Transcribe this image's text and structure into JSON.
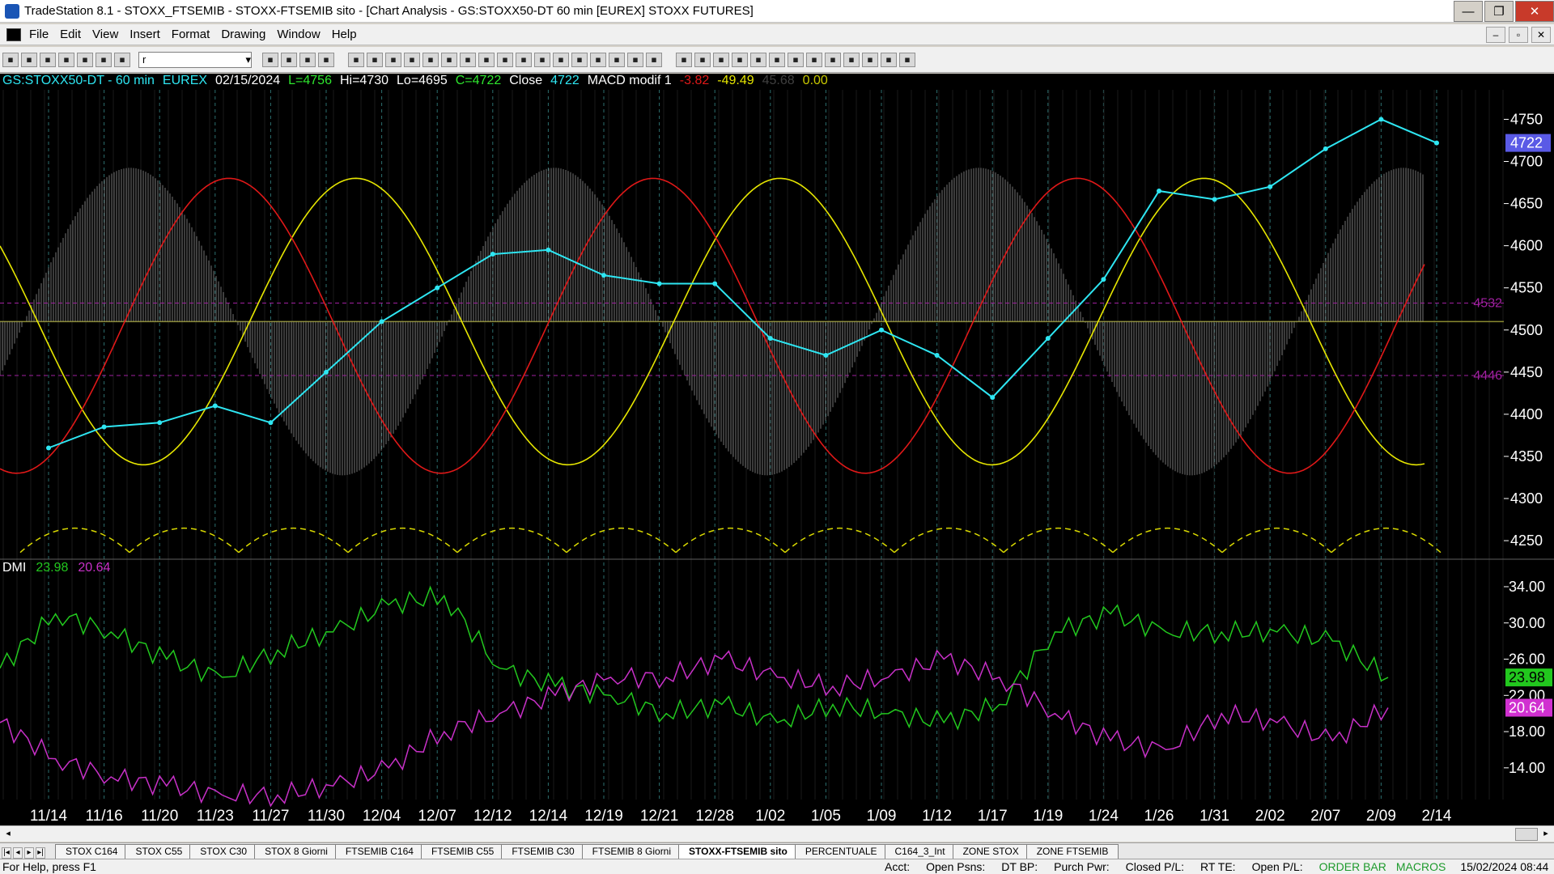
{
  "window": {
    "title": "TradeStation 8.1 - STOXX_FTSEMIB - STOXX-FTSEMIB sito - [Chart Analysis - GS:STOXX50-DT  60 min  [EUREX] STOXX FUTURES]",
    "minimize": "—",
    "restore": "❐",
    "close": "✕"
  },
  "menu": {
    "items": [
      "File",
      "Edit",
      "View",
      "Insert",
      "Format",
      "Drawing",
      "Window",
      "Help"
    ],
    "mdi": [
      "–",
      "▫",
      "✕"
    ]
  },
  "toolbar": {
    "symbol_value": "r",
    "icons_a": [
      "new-icon",
      "open-icon",
      "save-icon",
      "save-all-icon",
      "print-icon",
      "print-preview-icon",
      "workspace-icon",
      "workspace2-icon",
      "lock-icon",
      "format-icon",
      "colors-icon"
    ],
    "icons_b": [
      "insert-icon",
      "chart-icon",
      "indicator-icon",
      "study-icon",
      "strategy-icon",
      "data-icon",
      "bar-icon",
      "candle-icon",
      "line-icon",
      "point-icon",
      "zoom-in-icon",
      "zoom-out-icon",
      "cursor-icon",
      "hand-icon",
      "tools-icon",
      "export-icon",
      "grid-icon"
    ],
    "icons_c": [
      "trend-line-icon",
      "fib-icon",
      "hline-icon",
      "vline-icon",
      "arc-icon",
      "channel-icon",
      "gann-icon",
      "text-icon",
      "arrow-up-icon",
      "arrow-down-icon",
      "ellipse-icon",
      "rect-icon",
      "abc-icon"
    ]
  },
  "legend": {
    "symbol": "GS:STOXX50-DT - 60 min",
    "exchange": "EUREX",
    "date": "02/15/2024",
    "last": "L=4756",
    "hi": "Hi=4730",
    "lo": "Lo=4695",
    "close": "C=4722",
    "close_label": "Close",
    "close_val": "4722",
    "macd_name": "MACD modif 1",
    "macd_v1": "-3.82",
    "macd_v2": "-49.49",
    "macd_v3": "45.68",
    "macd_v4": "0.00"
  },
  "dmi": {
    "name": "DMI",
    "v1": "23.98",
    "v2": "20.64"
  },
  "colors": {
    "price": "#2ee6f2",
    "macd_red": "#e01818",
    "macd_yellow": "#e6e600",
    "hist": "#9a9a9a",
    "dmi_green": "#22c81e",
    "dmi_magenta": "#c830c8",
    "level_purple": "#a020a0"
  },
  "chart_data": [
    {
      "type": "line",
      "title": "GS:STOXX50-DT - 60 min",
      "y_ticks": [
        "4750",
        "4700",
        "4650",
        "4600",
        "4550",
        "4500",
        "4450",
        "4400",
        "4350",
        "4300",
        "4250"
      ],
      "ylim": [
        4228,
        4785
      ],
      "current_price_label": "4722",
      "levels": [
        {
          "label": "4532",
          "value": 4532
        },
        {
          "label": "4446",
          "value": 4446
        }
      ],
      "x_labels": [
        "11/14",
        "11/16",
        "11/20",
        "11/23",
        "11/27",
        "11/30",
        "12/04",
        "12/07",
        "12/12",
        "12/14",
        "12/19",
        "12/21",
        "12/28",
        "1/02",
        "1/05",
        "1/09",
        "1/12",
        "1/17",
        "1/19",
        "1/24",
        "1/26",
        "1/31",
        "2/02",
        "2/07",
        "2/09",
        "2/14"
      ],
      "series": [
        {
          "name": "Close",
          "x": [
            0,
            1,
            2,
            3,
            4,
            5,
            6,
            7,
            8,
            9,
            10,
            11,
            12,
            13,
            14,
            15,
            16,
            17,
            18,
            19,
            20,
            21,
            22,
            23,
            24,
            25
          ],
          "values": [
            4360,
            4385,
            4390,
            4410,
            4390,
            4450,
            4510,
            4550,
            4590,
            4595,
            4565,
            4555,
            4555,
            4490,
            4470,
            4500,
            4470,
            4420,
            4490,
            4560,
            4665,
            4655,
            4670,
            4715,
            4750,
            4722
          ]
        }
      ]
    },
    {
      "type": "line",
      "title": "DMI",
      "y_ticks": [
        "34.00",
        "30.00",
        "26.00",
        "22.00",
        "18.00",
        "14.00"
      ],
      "ylim": [
        10.5,
        36.5
      ],
      "series": [
        {
          "name": "23.98",
          "values": [
            25,
            31,
            29,
            26,
            24,
            27,
            29,
            32,
            33,
            25,
            23,
            22,
            20,
            21,
            19,
            21,
            20,
            19,
            21,
            29,
            31,
            29,
            29,
            29,
            28,
            23.98
          ]
        },
        {
          "name": "20.64",
          "values": [
            19,
            15,
            13,
            12,
            11,
            11,
            12,
            14,
            18,
            20,
            22,
            24,
            24,
            26,
            24,
            23,
            24,
            26,
            24,
            20,
            17,
            16,
            20,
            19,
            17,
            20.64
          ]
        }
      ]
    }
  ],
  "tabs": [
    "STOX C164",
    "STOX C55",
    "STOX  C30",
    "STOX  8 Giorni",
    "FTSEMIB C164",
    "FTSEMIB C55",
    "FTSEMIB C30",
    "FTSEMIB  8 Giorni",
    "STOXX-FTSEMIB sito",
    "PERCENTUALE",
    "C164_3_Int",
    "ZONE STOX",
    "ZONE FTSEMIB"
  ],
  "active_tab": "STOXX-FTSEMIB sito",
  "status": {
    "help": "For Help, press F1",
    "acct": "Acct:",
    "open_psns": "Open Psns:",
    "dt_bp": "DT BP:",
    "purch_pwr": "Purch Pwr:",
    "closed_pl": "Closed P/L:",
    "rt_te": "RT TE:",
    "open_pl": "Open P/L:",
    "order_bar": "ORDER BAR",
    "macros": "MACROS",
    "datetime": "15/02/2024 08:44"
  }
}
